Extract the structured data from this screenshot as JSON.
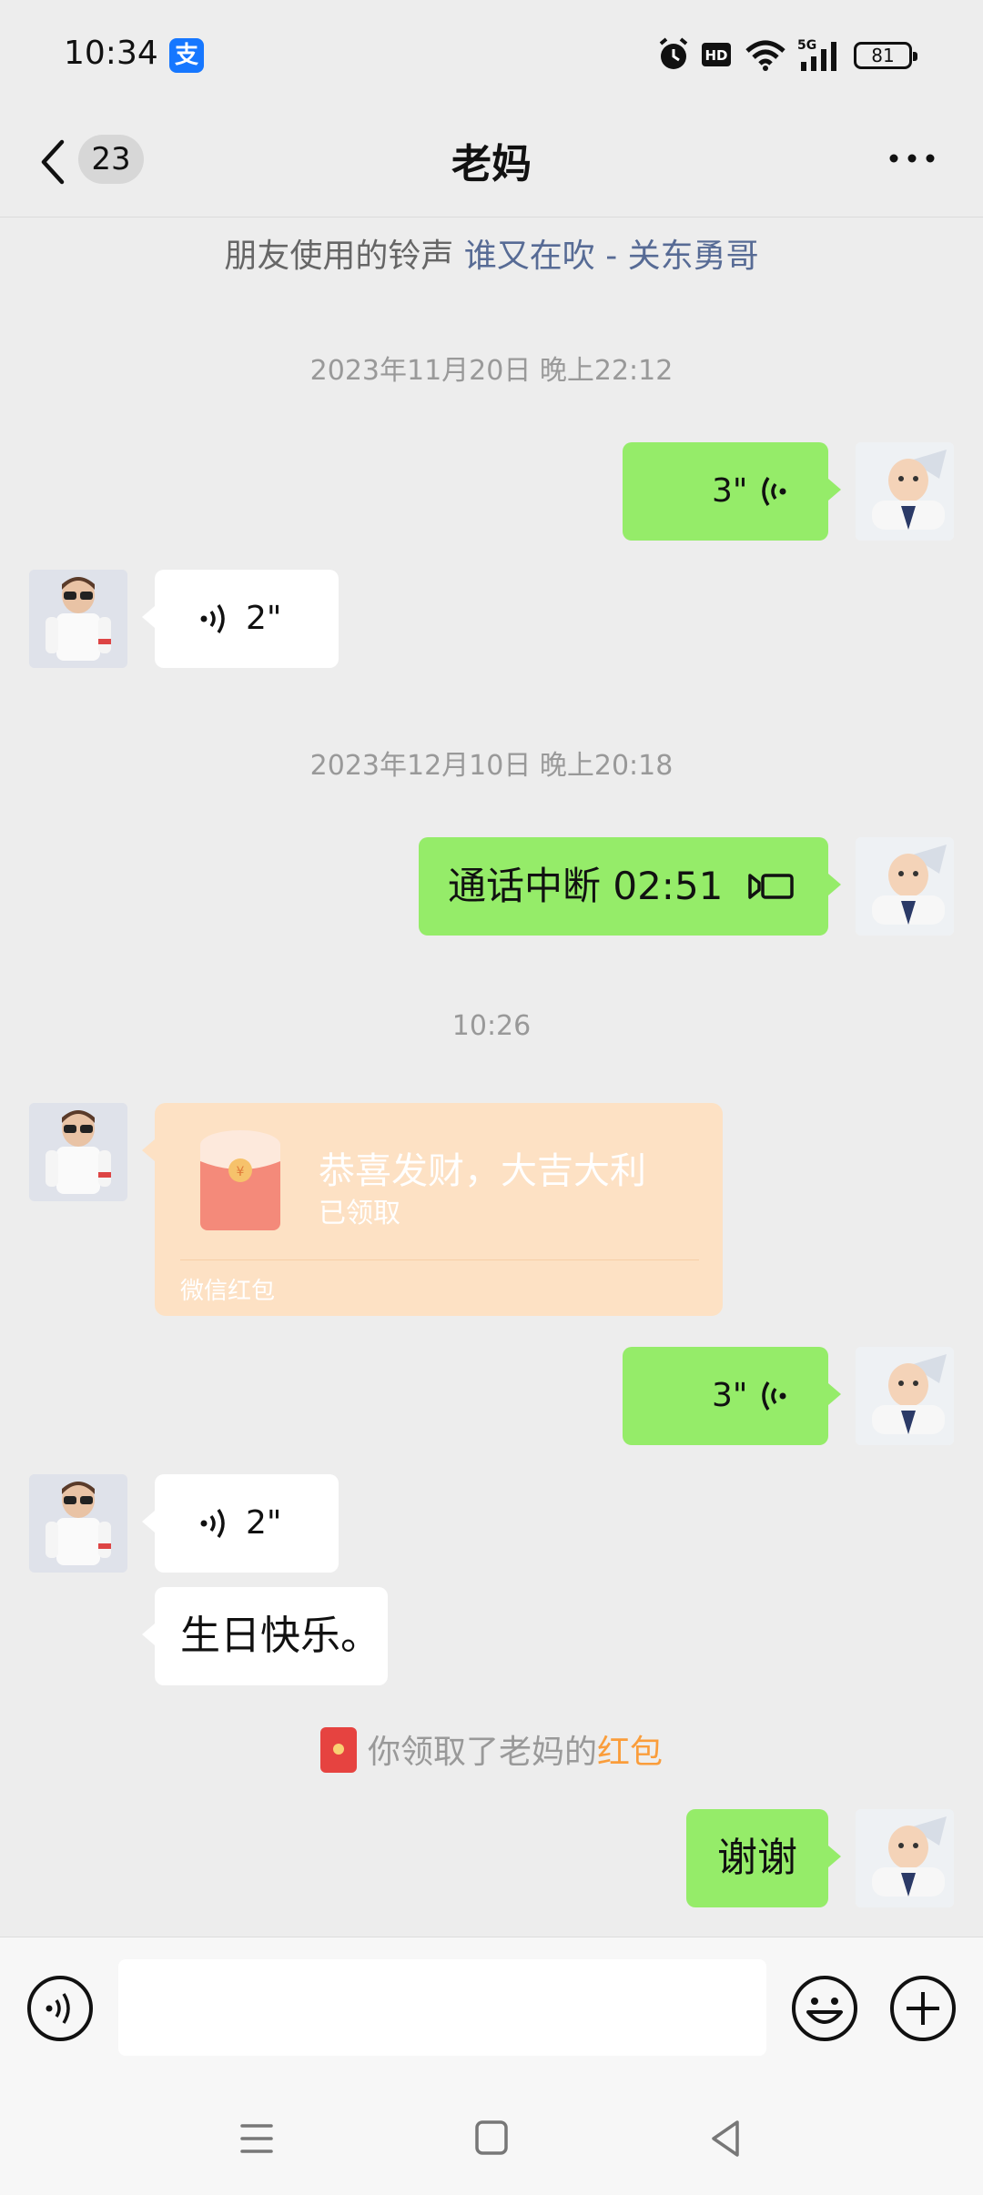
{
  "status_bar": {
    "time": "10:34",
    "app_icon": "alipay-icon",
    "app_icon_glyph": "支",
    "network_label": "5G",
    "battery": "81"
  },
  "header": {
    "unread_count": "23",
    "title": "老妈",
    "back_icon": "chevron-left-icon",
    "more_icon": "more-dots-icon"
  },
  "ringtone": {
    "prefix": "朋友使用的铃声 ",
    "song": "谁又在吹 - 关东勇哥"
  },
  "messages": {
    "ts1": "2023年11月20日 晚上22:12",
    "me_voice_1": "3\"",
    "mom_voice_1": "2\"",
    "ts2": "2023年12月10日 晚上20:18",
    "me_call": "通话中断 02:51",
    "ts3": "10:26",
    "red_packet": {
      "title": "恭喜发财，大吉大利",
      "status": "已领取",
      "brand": "微信红包"
    },
    "me_voice_2": "3\"",
    "mom_voice_2": "2\"",
    "mom_text": "生日快乐。",
    "system_notice_prefix": "你领取了老妈的",
    "system_notice_link": "红包",
    "me_text": "谢谢"
  },
  "input_bar": {
    "placeholder": "",
    "value": ""
  },
  "colors": {
    "background": "#ededed",
    "my_bubble": "#95ec69",
    "their_bubble": "#ffffff",
    "link": "#576b95",
    "red_packet_bg": "#fde1c4",
    "red_packet_link": "#fa9d3b"
  }
}
